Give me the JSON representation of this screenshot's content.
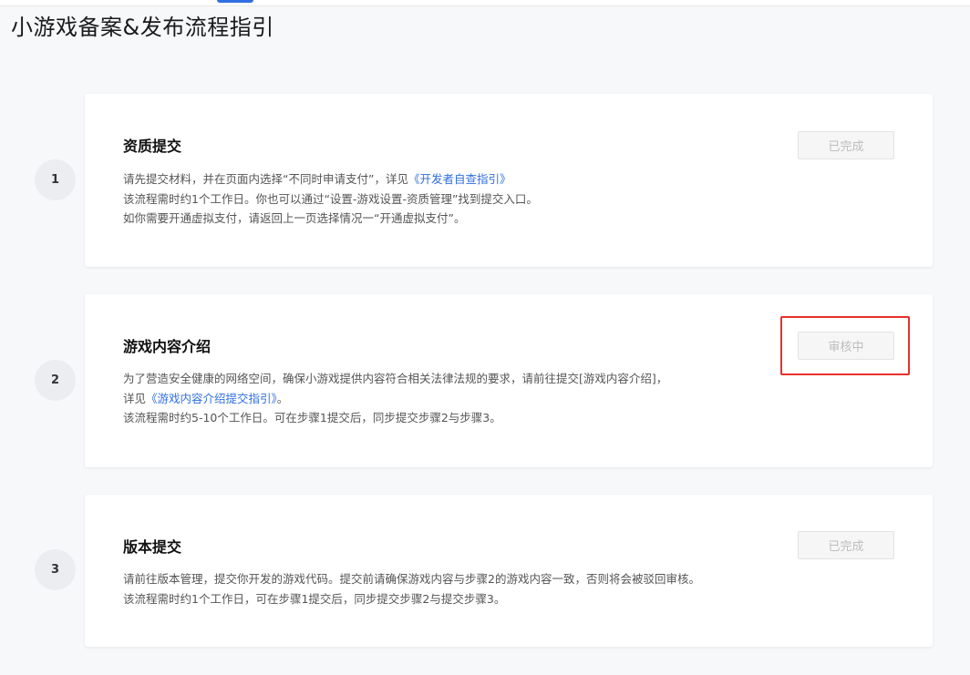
{
  "page": {
    "title": "小游戏备案&发布流程指引"
  },
  "steps": [
    {
      "number": "1",
      "title": "资质提交",
      "lines": [
        {
          "pre": "请先提交材料，并在页面内选择“不同时申请支付”，详见",
          "link": "《开发者自查指引》",
          "post": ""
        },
        {
          "pre": "该流程需时约1个工作日。你也可以通过“设置-游戏设置-资质管理”找到提交入口。",
          "link": "",
          "post": ""
        },
        {
          "pre": "如你需要开通虚拟支付，请返回上一页选择情况一“开通虚拟支付”。",
          "link": "",
          "post": ""
        }
      ],
      "status": "已完成"
    },
    {
      "number": "2",
      "title": "游戏内容介绍",
      "lines": [
        {
          "pre": "为了营造安全健康的网络空间，确保小游戏提供内容符合相关法律法规的要求，请前往提交[游戏内容介绍]，",
          "link": "",
          "post": ""
        },
        {
          "pre": "详见",
          "link": "《游戏内容介绍提交指引》",
          "post": "。"
        },
        {
          "pre": "该流程需时约5-10个工作日。可在步骤1提交后，同步提交步骤2与步骤3。",
          "link": "",
          "post": ""
        }
      ],
      "status": "审核中"
    },
    {
      "number": "3",
      "title": "版本提交",
      "lines": [
        {
          "pre": "请前往版本管理，提交你开发的游戏代码。提交前请确保游戏内容与步骤2的游戏内容一致，否则将会被驳回审核。",
          "link": "",
          "post": ""
        },
        {
          "pre": "该流程需时约1个工作日，可在步骤1提交后，同步提交步骤2与提交步骤3。",
          "link": "",
          "post": ""
        }
      ],
      "status": "已完成"
    }
  ],
  "colors": {
    "link": "#2f6fe0",
    "highlight": "#e8302a",
    "status_text": "#bdbdbd"
  }
}
